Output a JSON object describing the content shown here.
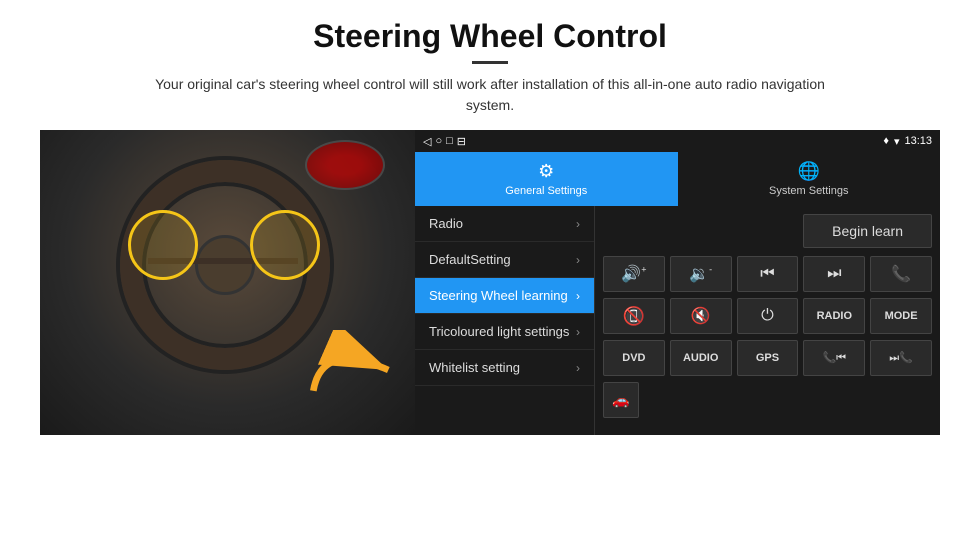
{
  "page": {
    "title": "Steering Wheel Control",
    "subtitle": "Your original car's steering wheel control will still work after installation of this all-in-one auto radio navigation system."
  },
  "status_bar": {
    "nav_back": "◁",
    "nav_home": "○",
    "nav_recents": "□",
    "nav_cast": "⊟",
    "location_icon": "♦",
    "wifi_icon": "▾",
    "time": "13:13"
  },
  "tabs": [
    {
      "id": "general",
      "label": "General Settings",
      "icon": "⚙",
      "active": true
    },
    {
      "id": "system",
      "label": "System Settings",
      "icon": "🌐",
      "active": false
    }
  ],
  "menu_items": [
    {
      "id": "radio",
      "label": "Radio",
      "active": false
    },
    {
      "id": "default",
      "label": "DefaultSetting",
      "active": false
    },
    {
      "id": "steering",
      "label": "Steering Wheel learning",
      "active": true
    },
    {
      "id": "tricoloured",
      "label": "Tricoloured light settings",
      "active": false
    },
    {
      "id": "whitelist",
      "label": "Whitelist setting",
      "active": false
    }
  ],
  "controls": {
    "begin_learn_label": "Begin learn",
    "row1": [
      {
        "id": "vol-up",
        "symbol": "🔊+",
        "label": "volume up"
      },
      {
        "id": "vol-down",
        "symbol": "🔉-",
        "label": "volume down"
      },
      {
        "id": "prev",
        "symbol": "⏮",
        "label": "previous"
      },
      {
        "id": "next",
        "symbol": "⏭",
        "label": "next"
      },
      {
        "id": "phone",
        "symbol": "📞",
        "label": "phone"
      }
    ],
    "row2": [
      {
        "id": "hang-up",
        "symbol": "↙",
        "label": "hang up"
      },
      {
        "id": "mute",
        "symbol": "🔇",
        "label": "mute"
      },
      {
        "id": "power",
        "symbol": "⏻",
        "label": "power"
      },
      {
        "id": "radio-btn",
        "symbol": "RADIO",
        "label": "radio",
        "text": true
      },
      {
        "id": "mode-btn",
        "symbol": "MODE",
        "label": "mode",
        "text": true
      }
    ],
    "row3": [
      {
        "id": "dvd",
        "symbol": "DVD",
        "label": "dvd",
        "text": true
      },
      {
        "id": "audio",
        "symbol": "AUDIO",
        "label": "audio",
        "text": true
      },
      {
        "id": "gps",
        "symbol": "GPS",
        "label": "gps",
        "text": true
      },
      {
        "id": "phone-prev",
        "symbol": "📞⏮",
        "label": "phone prev"
      },
      {
        "id": "phone-next",
        "symbol": "⏭📞",
        "label": "phone next"
      }
    ],
    "row4_icon": "🚗"
  }
}
